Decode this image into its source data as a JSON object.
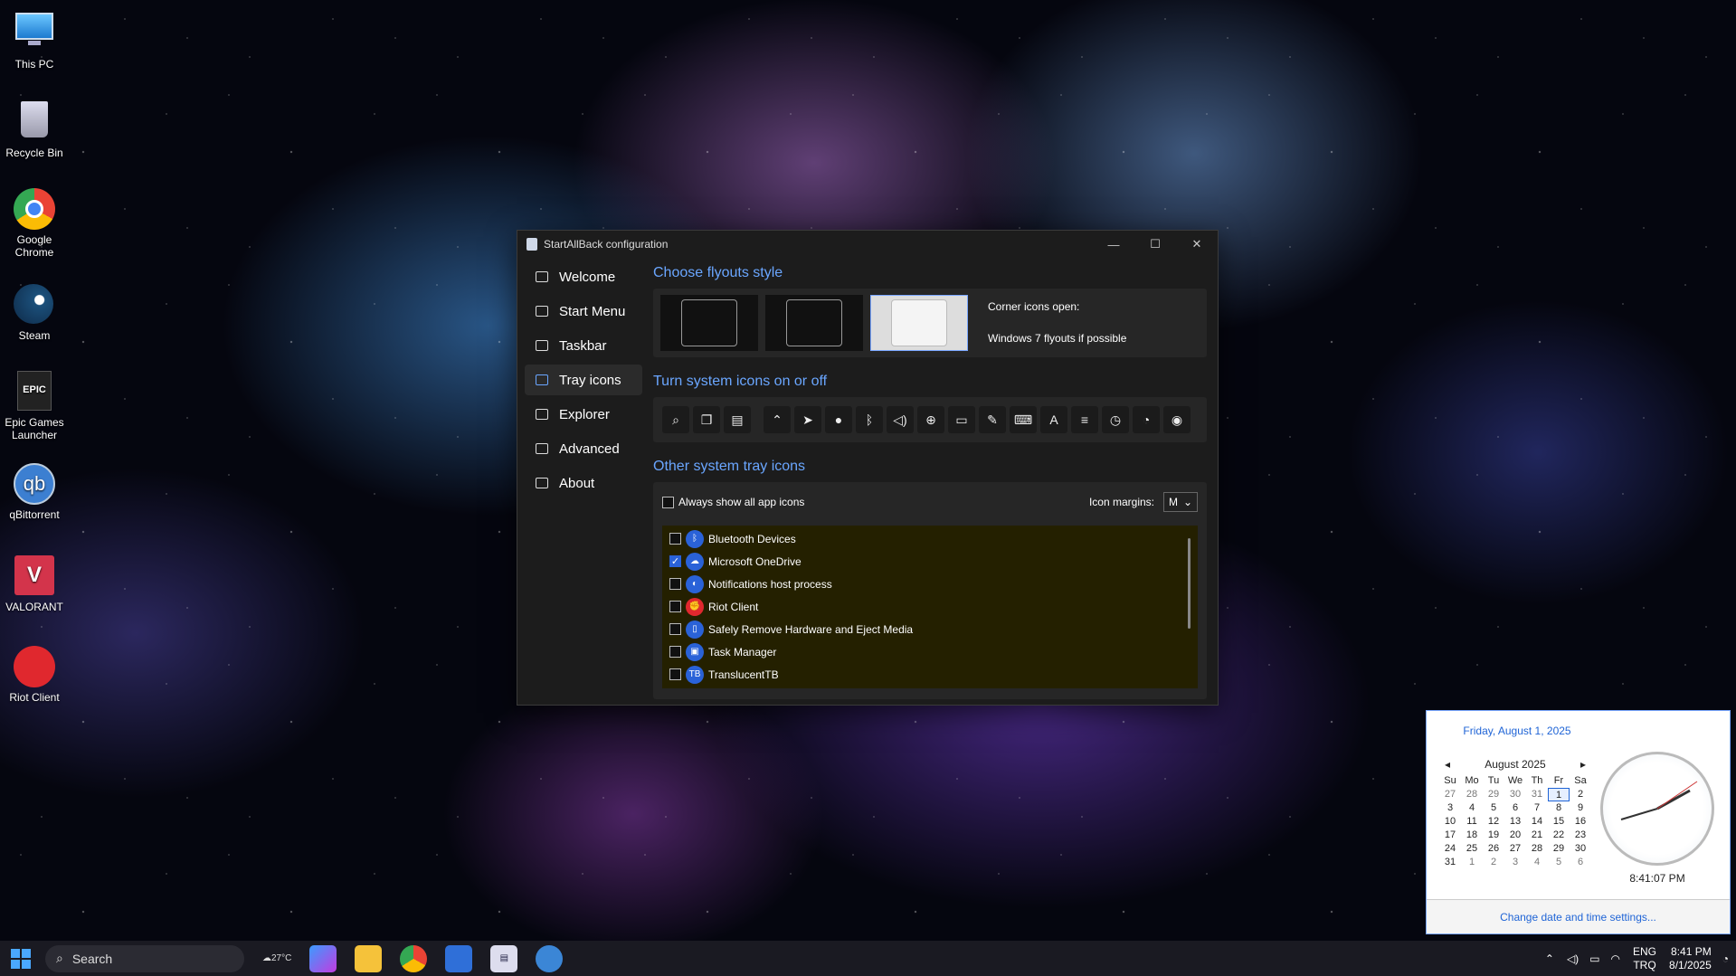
{
  "desktop": {
    "icons": [
      {
        "label": "This PC",
        "icon": "monitor-icon",
        "color": "#3fa0e0"
      },
      {
        "label": "Recycle Bin",
        "icon": "recycle-bin-icon",
        "color": "#9bb"
      },
      {
        "label": "Google Chrome",
        "icon": "chrome-icon",
        "color": "#e44"
      },
      {
        "label": "Steam",
        "icon": "steam-icon",
        "color": "#1b4f7a"
      },
      {
        "label": "Epic Games Launcher",
        "icon": "epic-games-icon",
        "color": "#222"
      },
      {
        "label": "qBittorrent",
        "icon": "qbittorrent-icon",
        "color": "#3c7fd1"
      },
      {
        "label": "VALORANT",
        "icon": "valorant-icon",
        "color": "#d3344b"
      },
      {
        "label": "Riot Client",
        "icon": "riot-client-icon",
        "color": "#e0282e"
      }
    ]
  },
  "window": {
    "title": "StartAllBack configuration",
    "minimize": "—",
    "maximize": "☐",
    "close": "✕"
  },
  "nav": [
    {
      "label": "Welcome",
      "icon": "wave-icon"
    },
    {
      "label": "Start Menu",
      "icon": "start-menu-icon"
    },
    {
      "label": "Taskbar",
      "icon": "taskbar-icon"
    },
    {
      "label": "Tray icons",
      "icon": "tray-icon",
      "selected": true
    },
    {
      "label": "Explorer",
      "icon": "folder-icon"
    },
    {
      "label": "Advanced",
      "icon": "wrench-icon"
    },
    {
      "label": "About",
      "icon": "about-icon"
    }
  ],
  "flyouts": {
    "heading": "Choose flyouts style",
    "line1": "Corner icons open:",
    "line2": "Windows 7 flyouts if possible",
    "selected_index": 2
  },
  "system_icons": {
    "heading": "Turn system icons on or off",
    "icons": [
      "search-icon",
      "task-view-icon",
      "widgets-icon",
      "chevron-up-icon",
      "location-icon",
      "microphone-icon",
      "bluetooth-icon",
      "volume-icon",
      "network-icon",
      "battery-icon",
      "pen-icon",
      "keyboard-icon",
      "language-icon",
      "settings-sliders-icon",
      "clock-icon",
      "bell-icon",
      "eye-icon"
    ]
  },
  "other_tray": {
    "heading": "Other system tray icons",
    "always_show": "Always show all app icons",
    "icon_margins_label": "Icon margins:",
    "icon_margins_value": "M",
    "apps": [
      {
        "name": "Bluetooth Devices",
        "checked": false,
        "icon": "bluetooth-icon"
      },
      {
        "name": "Microsoft OneDrive",
        "checked": true,
        "icon": "onedrive-icon"
      },
      {
        "name": "Notifications host process",
        "checked": false,
        "icon": "notifications-icon"
      },
      {
        "name": "Riot Client",
        "checked": false,
        "icon": "riot-client-icon"
      },
      {
        "name": "Safely Remove Hardware and Eject Media",
        "checked": false,
        "icon": "usb-icon"
      },
      {
        "name": "Task Manager",
        "checked": false,
        "icon": "task-manager-icon"
      },
      {
        "name": "TranslucentTB",
        "checked": false,
        "icon": "translucenttb-icon"
      }
    ]
  },
  "calendar": {
    "full_date": "Friday, August 1, 2025",
    "month": "August 2025",
    "prev": "◂",
    "next": "▸",
    "weekdays": [
      "Su",
      "Mo",
      "Tu",
      "We",
      "Th",
      "Fr",
      "Sa"
    ],
    "days": [
      "27",
      "28",
      "29",
      "30",
      "31",
      "1",
      "2",
      "3",
      "4",
      "5",
      "6",
      "7",
      "8",
      "9",
      "10",
      "11",
      "12",
      "13",
      "14",
      "15",
      "16",
      "17",
      "18",
      "19",
      "20",
      "21",
      "22",
      "23",
      "24",
      "25",
      "26",
      "27",
      "28",
      "29",
      "30",
      "31",
      "1",
      "2",
      "3",
      "4",
      "5",
      "6"
    ],
    "time": "8:41:07 PM",
    "link": "Change date and time settings..."
  },
  "taskbar": {
    "search": "Search",
    "weather": "27°C",
    "lang1": "ENG",
    "lang2": "TRQ",
    "time": "8:41 PM",
    "date": "8/1/2025"
  }
}
